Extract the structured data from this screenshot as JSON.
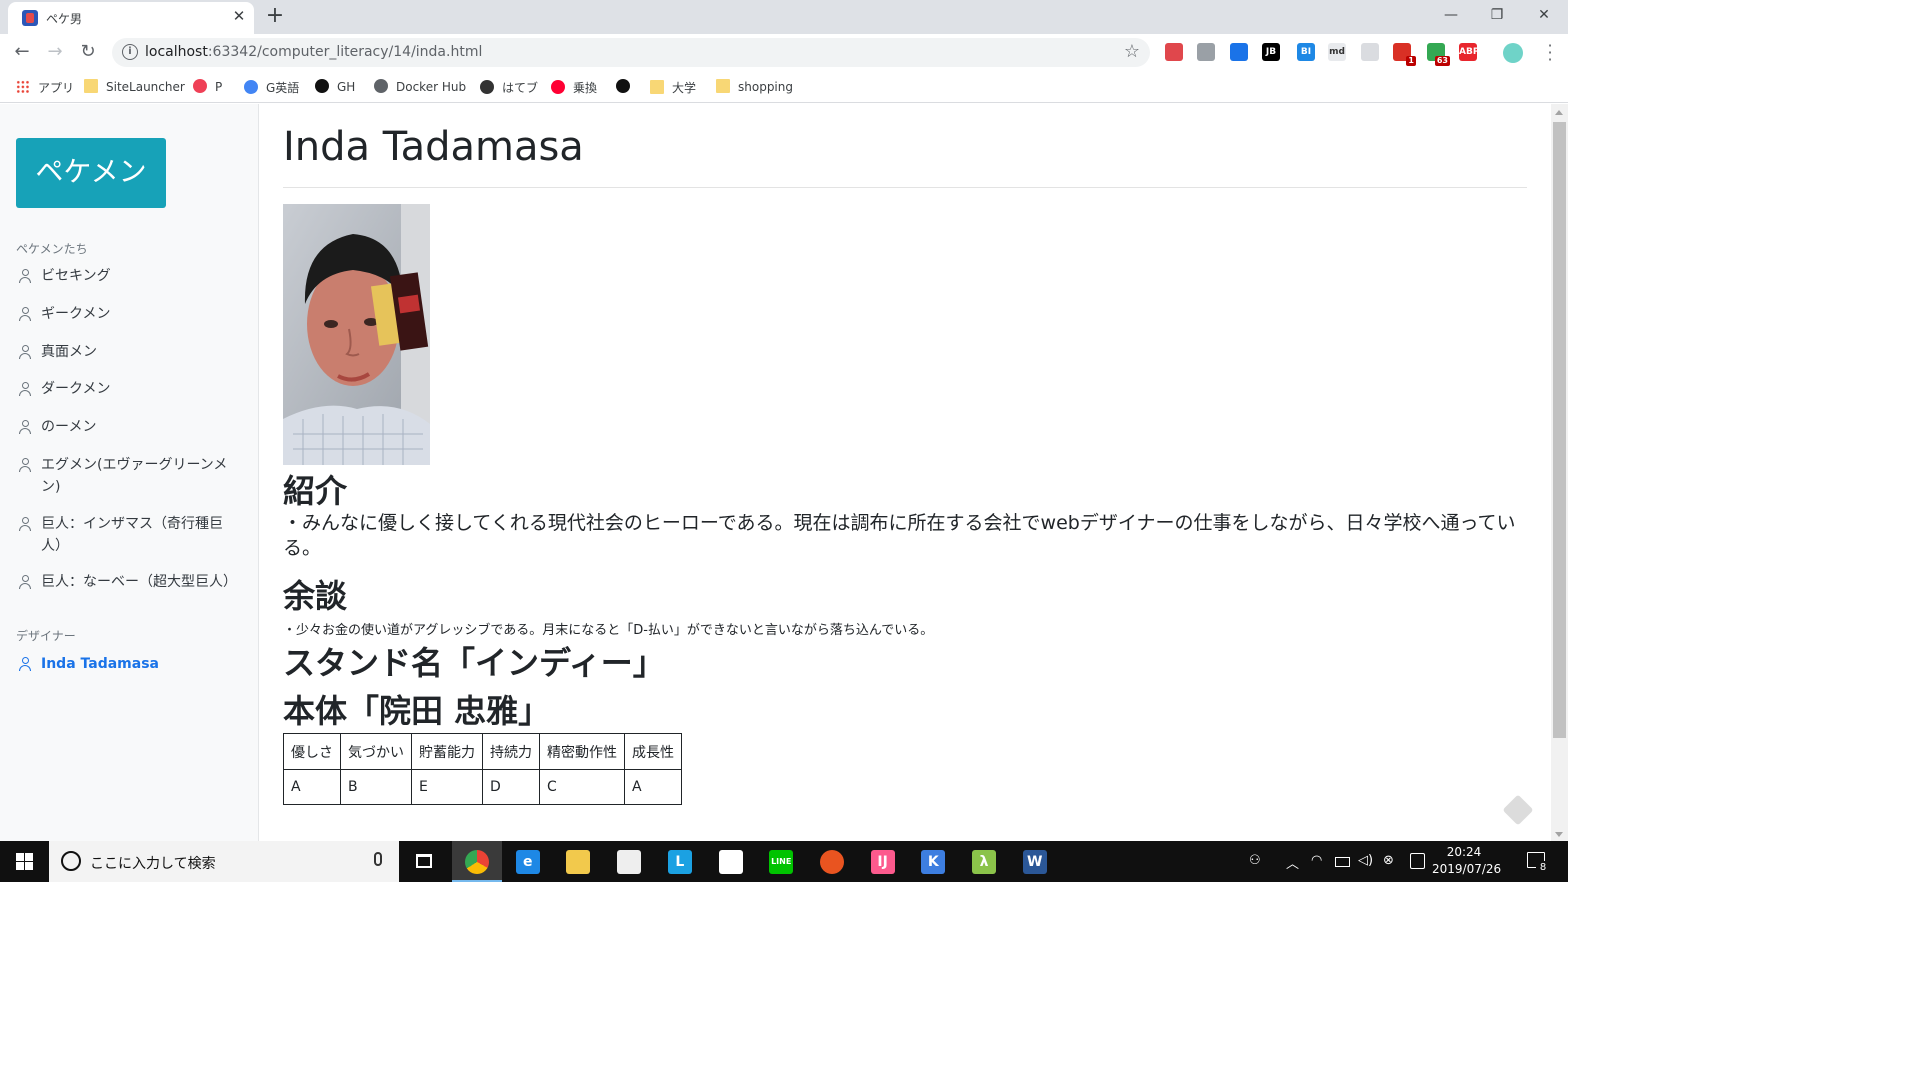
{
  "browser": {
    "tab_title": "ペケ男",
    "tab_close": "✕",
    "new_tab": "+",
    "url_host": "localhost",
    "url_path": ":63342/computer_literacy/14/inda.html",
    "window_controls": {
      "minimize": "—",
      "restore": "❐",
      "close": "✕"
    },
    "extensions": [
      {
        "name": "shield-extension-icon",
        "color": "#e0474c",
        "label": ""
      },
      {
        "name": "cursor-extension-icon",
        "color": "#9aa0a6",
        "label": ""
      },
      {
        "name": "screenshot-extension-icon",
        "color": "#1a73e8",
        "label": ""
      },
      {
        "name": "jb-extension-icon",
        "color": "#000000",
        "label": "JB"
      },
      {
        "name": "bl-extension-icon",
        "color": "#1e88e5",
        "label": "BI"
      },
      {
        "name": "md-extension-icon",
        "color": "#e8eaed",
        "label": "md"
      },
      {
        "name": "lock-extension-icon",
        "color": "#dadce0",
        "label": ""
      },
      {
        "name": "todo-extension-icon",
        "color": "#d93025",
        "label": "",
        "badge": "1"
      },
      {
        "name": "home-extension-icon",
        "color": "#34a853",
        "label": "",
        "badge": "63"
      },
      {
        "name": "abp-extension-icon",
        "color": "#e8262d",
        "label": "ABP"
      }
    ]
  },
  "bookmarks": [
    {
      "label": "アプリ",
      "icon": "apps-icon"
    },
    {
      "label": "SiteLauncher",
      "icon": "folder-icon"
    },
    {
      "label": "P",
      "icon": "pocket-icon"
    },
    {
      "label": "G英語",
      "icon": "google-icon"
    },
    {
      "label": "GH",
      "icon": "github-icon"
    },
    {
      "label": "Docker Hub",
      "icon": "docker-icon"
    },
    {
      "label": "はてブ",
      "icon": "hatena-icon"
    },
    {
      "label": "乗換",
      "icon": "yahoo-icon"
    },
    {
      "label": "",
      "icon": "one-icon"
    },
    {
      "label": "大学",
      "icon": "folder-icon"
    },
    {
      "label": "shopping",
      "icon": "folder-icon"
    }
  ],
  "sidebar": {
    "brand": "ペケメン",
    "section1_label": "ペケメンたち",
    "members": [
      "ビセキング",
      "ギークメン",
      "真面メン",
      "ダークメン",
      "のーメン",
      "エグメン(エヴァーグリーンメン)",
      "巨人：インザマス（奇行種巨人）",
      "巨人：なーベー（超大型巨人）"
    ],
    "section2_label": "デザイナー",
    "designer": "Inda Tadamasa"
  },
  "main": {
    "title": "Inda Tadamasa",
    "intro_heading": "紹介",
    "intro_text": "・みんなに優しく接してくれる現代社会のヒーローである。現在は調布に所在する会社でwebデザイナーの仕事をしながら、日々学校へ通っている。",
    "aside_heading": "余談",
    "aside_text": "・少々お金の使い道がアグレッシブである。月末になると「D-払い」ができないと言いながら落ち込んでいる。",
    "stand_heading": "スタンド名「インディー」",
    "body_heading": "本体「院田 忠雅」",
    "stats_headers": [
      "優しさ",
      "気づかい",
      "貯蓄能力",
      "持続力",
      "精密動作性",
      "成長性"
    ],
    "stats_values": [
      "A",
      "B",
      "E",
      "D",
      "C",
      "A"
    ]
  },
  "taskbar": {
    "search_placeholder": "ここに入力して検索",
    "time": "20:24",
    "date": "2019/07/26",
    "notification_count": "8",
    "apps": [
      {
        "name": "chrome-app",
        "color": "#4285f4",
        "label": "",
        "active": true
      },
      {
        "name": "edge-app",
        "color": "#1e88e5",
        "label": "e",
        "active": false
      },
      {
        "name": "explorer-app",
        "color": "#f2c94c",
        "label": "",
        "active": false
      },
      {
        "name": "store-app",
        "color": "#eeeeee",
        "label": "",
        "active": false
      },
      {
        "name": "l-app",
        "color": "#1ba1e2",
        "label": "L",
        "active": false
      },
      {
        "name": "mail-app",
        "color": "#ffffff",
        "label": "",
        "active": false
      },
      {
        "name": "line-app",
        "color": "#00c300",
        "label": "LINE",
        "active": false
      },
      {
        "name": "ubuntu-app",
        "color": "#e95420",
        "label": "",
        "active": false
      },
      {
        "name": "intellij-app",
        "color": "#fc5a8d",
        "label": "IJ",
        "active": false
      },
      {
        "name": "kotlin-app",
        "color": "#3d7ee0",
        "label": "K",
        "active": false
      },
      {
        "name": "lambda-app",
        "color": "#8bc34a",
        "label": "λ",
        "active": false
      },
      {
        "name": "word-app",
        "color": "#2b5797",
        "label": "W",
        "active": false
      }
    ]
  }
}
